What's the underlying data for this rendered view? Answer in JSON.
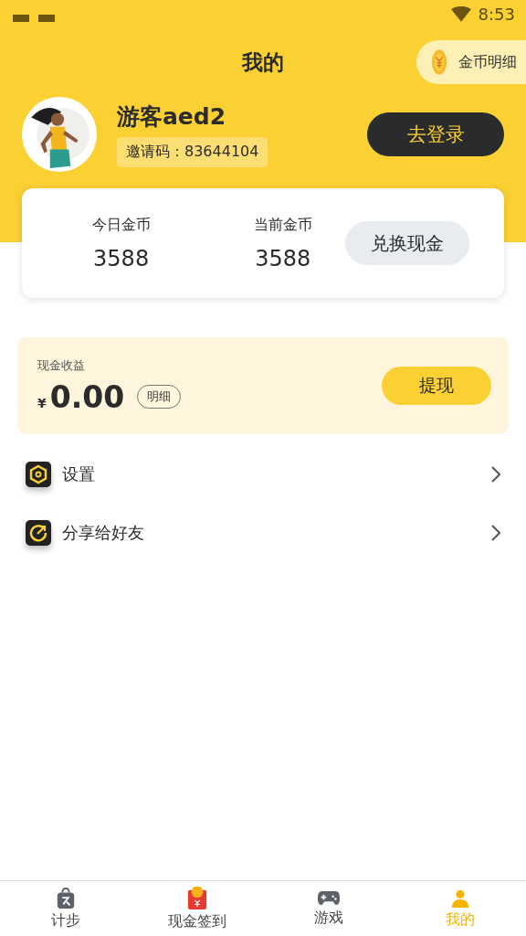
{
  "status_bar": {
    "time": "8:53"
  },
  "header": {
    "title": "我的",
    "coin_detail": "金币明细"
  },
  "profile": {
    "name": "游客aed2",
    "invite_label": "邀请码：",
    "invite_code": "83644104",
    "login_button": "去登录"
  },
  "coins": {
    "stats": [
      {
        "label": "今日金币",
        "value": "3588"
      },
      {
        "label": "当前金币",
        "value": "3588"
      }
    ],
    "exchange_button": "兑换现金"
  },
  "cash": {
    "label": "现金收益",
    "currency": "¥",
    "amount": "0.00",
    "detail_button": "明细",
    "withdraw_button": "提现"
  },
  "menu": [
    {
      "kind": "settings",
      "label": "设置"
    },
    {
      "kind": "share",
      "label": "分享给好友"
    }
  ],
  "tabs": [
    {
      "kind": "steps",
      "label": "计步",
      "selected": false
    },
    {
      "kind": "cash",
      "label": "现金签到",
      "selected": false
    },
    {
      "kind": "game",
      "label": "游戏",
      "selected": false
    },
    {
      "kind": "me",
      "label": "我的",
      "selected": true
    }
  ]
}
